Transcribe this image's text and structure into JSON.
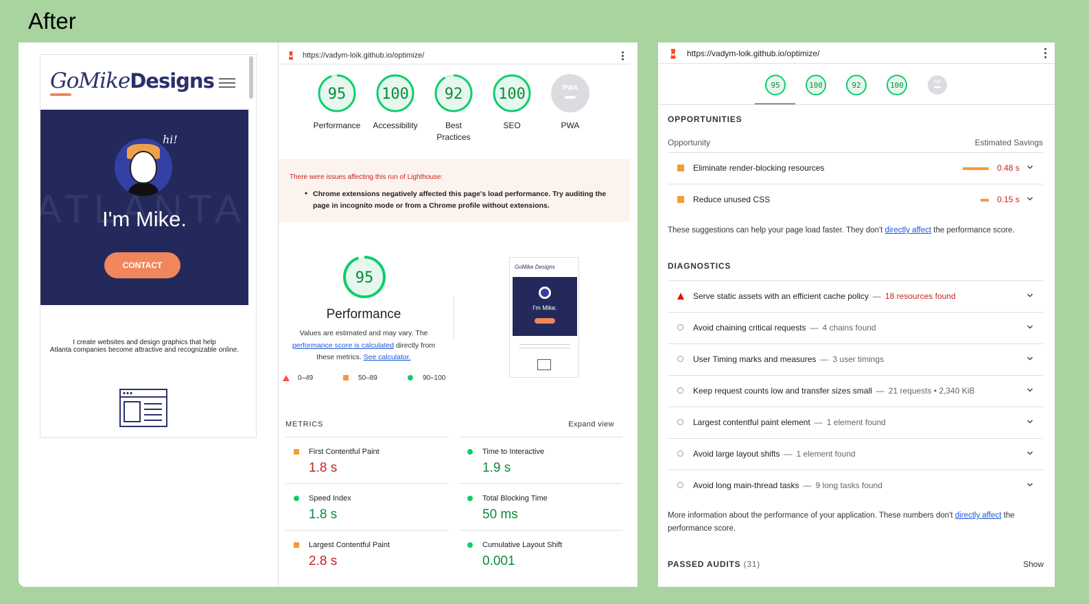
{
  "heading": "After",
  "site": {
    "logo_part1": "GoMike",
    "logo_part2": "Designs",
    "hero_bg_text": "ATLANTA",
    "hi": "hi!",
    "hero_title": "I'm Mike.",
    "contact_label": "CONTACT",
    "description_line1": "I create websites and design graphics that help",
    "description_line2": "Atlanta companies become attractive and recognizable online."
  },
  "report": {
    "url": "https://vadym-loik.github.io/optimize/",
    "gauges": [
      {
        "score": "95",
        "label": "Performance",
        "fraction": 0.95
      },
      {
        "score": "100",
        "label": "Accessibility",
        "fraction": 1.0
      },
      {
        "score": "92",
        "label": "Best Practices",
        "fraction": 0.92
      },
      {
        "score": "100",
        "label": "SEO",
        "fraction": 1.0
      },
      {
        "score": "PWA",
        "label": "PWA",
        "fraction": 0
      }
    ],
    "warning_title": "There were issues affecting this run of Lighthouse:",
    "warning_item": "Chrome extensions negatively affected this page's load performance. Try auditing the page in incognito mode or from a Chrome profile without extensions.",
    "perf_score": "95",
    "perf_title": "Performance",
    "perf_desc_1": "Values are estimated and may vary. The",
    "perf_desc_link1": "performance score is calculated",
    "perf_desc_2": "directly from these metrics.",
    "perf_desc_link2": "See calculator.",
    "legend": {
      "fail": "0–49",
      "average": "50–89",
      "pass": "90–100"
    },
    "thumb_logo": "GoMike Designs",
    "thumb_title": "I'm Mike.",
    "metrics_label": "METRICS",
    "expand_view": "Expand view",
    "metrics": [
      {
        "name": "First Contentful Paint",
        "value": "1.8 s",
        "status": "average",
        "color": "#c5221f"
      },
      {
        "name": "Time to Interactive",
        "value": "1.9 s",
        "status": "pass",
        "color": "#0a8a3d"
      },
      {
        "name": "Speed Index",
        "value": "1.8 s",
        "status": "pass",
        "color": "#0a8a3d"
      },
      {
        "name": "Total Blocking Time",
        "value": "50 ms",
        "status": "pass",
        "color": "#0a8a3d"
      },
      {
        "name": "Largest Contentful Paint",
        "value": "2.8 s",
        "status": "average",
        "color": "#c5221f"
      },
      {
        "name": "Cumulative Layout Shift",
        "value": "0.001",
        "status": "pass",
        "color": "#0a8a3d"
      }
    ]
  },
  "report2": {
    "url": "https://vadym-loik.github.io/optimize/",
    "mini_gauges": [
      "95",
      "100",
      "92",
      "100",
      "PWA"
    ],
    "opportunities_heading": "OPPORTUNITIES",
    "opportunity_col": "Opportunity",
    "savings_col": "Estimated Savings",
    "opportunities": [
      {
        "title": "Eliminate render-blocking resources",
        "savings": "0.48 s",
        "fraction": 1.0
      },
      {
        "title": "Reduce unused CSS",
        "savings": "0.15 s",
        "fraction": 0.31
      }
    ],
    "suggest_text_1": "These suggestions can help your page load faster. They don't",
    "suggest_link": "directly affect",
    "suggest_text_2": "the performance score.",
    "diagnostics_heading": "DIAGNOSTICS",
    "diagnostics": [
      {
        "title": "Serve static assets with an efficient cache policy",
        "detail": "18 resources found",
        "status": "fail"
      },
      {
        "title": "Avoid chaining critical requests",
        "detail": "4 chains found",
        "status": "info"
      },
      {
        "title": "User Timing marks and measures",
        "detail": "3 user timings",
        "status": "info"
      },
      {
        "title": "Keep request counts low and transfer sizes small",
        "detail": "21 requests • 2,340 KiB",
        "status": "info"
      },
      {
        "title": "Largest contentful paint element",
        "detail": "1 element found",
        "status": "info"
      },
      {
        "title": "Avoid large layout shifts",
        "detail": "1 element found",
        "status": "info"
      },
      {
        "title": "Avoid long main-thread tasks",
        "detail": "9 long tasks found",
        "status": "info"
      }
    ],
    "more_info_1": "More information about the performance of your application. These numbers don't",
    "more_info_link": "directly affect",
    "more_info_2": "the",
    "more_info_3": "performance score.",
    "passed_heading": "PASSED AUDITS",
    "passed_count": "(31)",
    "show_label": "Show"
  },
  "colors": {
    "pass": "#0cce6b",
    "average": "#f29b38",
    "fail": "#ff4e42",
    "link": "#1a56db"
  }
}
